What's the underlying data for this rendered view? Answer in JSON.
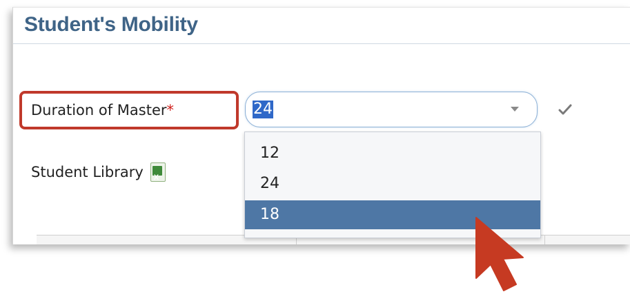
{
  "header": {
    "title": "Student's Mobility"
  },
  "form": {
    "duration_label": "Duration of Master",
    "required_marker": "*",
    "duration_value": "24",
    "library_label": "Student Library",
    "library_icon": "excel-file-icon",
    "confirm_icon": "checkmark-icon"
  },
  "dropdown": {
    "options": [
      "12",
      "24",
      "18"
    ],
    "highlighted": "18"
  },
  "colors": {
    "title": "#3f6487",
    "highlight_box": "#c0392b",
    "selection": "#2f68c8",
    "option_hover": "#4e77a5",
    "cursor": "#c63a22"
  }
}
